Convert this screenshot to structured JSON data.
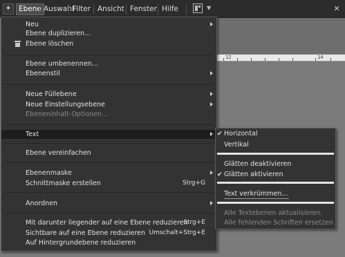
{
  "menubar": {
    "items": [
      "Ebene",
      "Auswahl",
      "Filter",
      "Ansicht",
      "Fenster",
      "Hilfe"
    ],
    "active": "Ebene"
  },
  "ruler": {
    "labels": [
      "12",
      "14"
    ]
  },
  "menu": [
    {
      "label": "Neu",
      "submenu": true
    },
    {
      "label": "Ebene duplizieren..."
    },
    {
      "label": "Ebene löschen",
      "icon": "trash-icon"
    },
    {
      "label": "Ebene umbenennen..."
    },
    {
      "label": "Ebenenstil",
      "submenu": true
    },
    {
      "label": "Neue Füllebene",
      "submenu": true
    },
    {
      "label": "Neue Einstellungsebene",
      "submenu": true
    },
    {
      "label": "Ebeneninhalt-Optionen...",
      "disabled": true
    },
    {
      "label": "Text",
      "submenu": true,
      "highlighted": true
    },
    {
      "label": "Ebene vereinfachen"
    },
    {
      "label": "Ebenenmaske",
      "submenu": true
    },
    {
      "label": "Schnittmaske erstellen",
      "shortcut": "Strg+G"
    },
    {
      "label": "Anordnen",
      "submenu": true
    },
    {
      "label": "Mit darunter liegender auf eine Ebene reduzieren",
      "shortcut": "Strg+E"
    },
    {
      "label": "Sichtbare auf eine Ebene reduzieren",
      "shortcut": "Umschalt+Strg+E"
    },
    {
      "label": "Auf Hintergrundebene reduzieren"
    }
  ],
  "text_submenu": [
    {
      "label": "Horizontal",
      "checked": true
    },
    {
      "label": "Vertikal"
    },
    {
      "label": "Glätten deaktivieren"
    },
    {
      "label": "Glätten aktivieren",
      "checked": true
    },
    {
      "label": "Text verkrümmen..."
    },
    {
      "label": "Alle Textebenen aktualisieren",
      "disabled": true
    },
    {
      "label": "Alle fehlenden Schriften ersetzen",
      "disabled": true
    }
  ]
}
